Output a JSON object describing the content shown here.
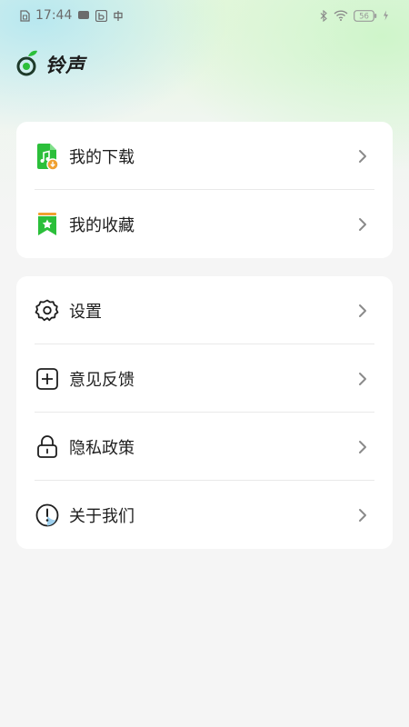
{
  "status_bar": {
    "time": "17:44",
    "battery": "56",
    "icons_left": [
      "sim-icon",
      "message-icon",
      "b-app-icon",
      "zhong-app-icon"
    ],
    "icons_right": [
      "bluetooth-icon",
      "wifi-icon",
      "battery-icon",
      "charging-icon"
    ]
  },
  "brand": {
    "title": "铃声",
    "logo_icon": "music-note-leaf-icon",
    "accent": "#2bbf3a"
  },
  "menu_group_1": [
    {
      "label": "我的下载",
      "icon": "music-download-icon"
    },
    {
      "label": "我的收藏",
      "icon": "bookmark-star-icon"
    }
  ],
  "menu_group_2": [
    {
      "label": "设置",
      "icon": "gear-icon"
    },
    {
      "label": "意见反馈",
      "icon": "plus-square-icon"
    },
    {
      "label": "隐私政策",
      "icon": "lock-icon"
    },
    {
      "label": "关于我们",
      "icon": "info-circle-icon"
    }
  ],
  "colors": {
    "green": "#2bbf3a",
    "orange": "#f0a030",
    "chevron": "#8a8a8a",
    "text": "#1e1e1e"
  }
}
